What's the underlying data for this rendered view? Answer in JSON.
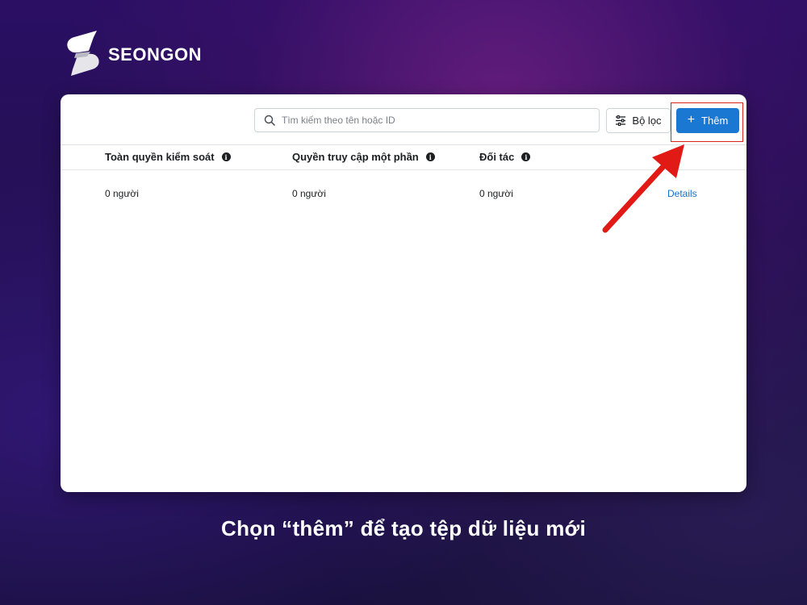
{
  "brand": {
    "name": "SEONGON",
    "logo_icon": "seongon-s-logo-icon"
  },
  "toolbar": {
    "search": {
      "placeholder": "Tìm kiếm theo tên hoặc ID",
      "value": "",
      "icon": "search-icon"
    },
    "filter_label": "Bộ lọc",
    "filter_icon": "sliders-icon",
    "add_label": "Thêm",
    "add_icon": "plus-icon"
  },
  "table": {
    "headers": [
      "Toàn quyền kiểm soát",
      "Quyền truy cập một phần",
      "Đối tác"
    ],
    "rows": [
      {
        "cells": [
          "0 người",
          "0 người",
          "0 người"
        ],
        "action": "Details"
      }
    ]
  },
  "annotation": {
    "highlight_color": "#d9241b",
    "arrow_color": "#e21a16"
  },
  "colors": {
    "primary_button": "#1a77d2",
    "link": "#1a6fc4",
    "background_top": "#2a0f63",
    "background_bottom": "#18103a"
  },
  "caption": "Chọn “thêm” để tạo tệp dữ liệu mới"
}
